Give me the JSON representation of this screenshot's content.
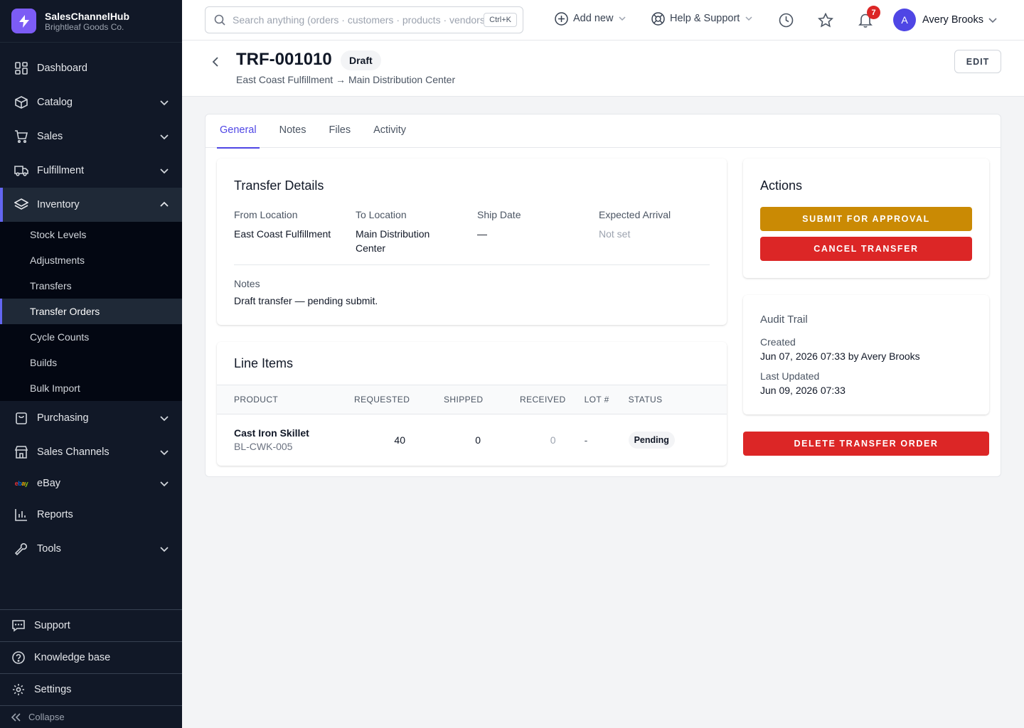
{
  "brand": {
    "name": "SalesChannelHub",
    "company": "Brightleaf Goods Co.",
    "logo_color": "#7c5cf5"
  },
  "sidebar": {
    "items": [
      {
        "label": "Dashboard",
        "icon": "dashboard-icon"
      },
      {
        "label": "Catalog",
        "icon": "box-icon"
      },
      {
        "label": "Sales",
        "icon": "cart-icon"
      },
      {
        "label": "Fulfillment",
        "icon": "truck-icon"
      },
      {
        "label": "Inventory",
        "icon": "layers-icon",
        "expanded": true
      }
    ],
    "inventory_sub": [
      "Stock Levels",
      "Adjustments",
      "Transfers",
      "Transfer Orders",
      "Cycle Counts",
      "Builds",
      "Bulk Import"
    ],
    "active_sub": "Transfer Orders",
    "items_after": [
      {
        "label": "Purchasing",
        "icon": "bag-icon"
      },
      {
        "label": "Sales Channels",
        "icon": "store-icon"
      },
      {
        "label": "eBay",
        "icon": "ebay-icon",
        "logo_text": "ebay"
      },
      {
        "label": "Reports",
        "icon": "bar-chart-icon"
      },
      {
        "label": "Tools",
        "icon": "wrench-icon"
      }
    ],
    "bottom": {
      "support": "Support",
      "knowledge": "Knowledge base",
      "settings": "Settings",
      "collapse": "Collapse"
    }
  },
  "topbar": {
    "search_placeholder": "Search anything (orders · customers · products · vendors)",
    "shortcut": "Ctrl+K",
    "add_new": "Add new",
    "help": "Help & Support",
    "notifications_count": "7",
    "user_initial": "A",
    "user_name": "Avery Brooks"
  },
  "header": {
    "title": "TRF-001010",
    "status": "Draft",
    "route": "East Coast Fulfillment → Main Distribution Center",
    "edit_label": "EDIT"
  },
  "tabs": [
    "General",
    "Notes",
    "Files",
    "Activity"
  ],
  "details": {
    "title": "Transfer Details",
    "from_label": "From Location",
    "from_value": "East Coast Fulfillment",
    "to_label": "To Location",
    "to_value": "Main Distribution Center",
    "ship_label": "Ship Date",
    "ship_value": "—",
    "arrival_label": "Expected Arrival",
    "arrival_value": "Not set",
    "notes_label": "Notes",
    "notes_value": "Draft transfer — pending submit."
  },
  "line_items": {
    "title": "Line Items",
    "columns": [
      "PRODUCT",
      "REQUESTED",
      "SHIPPED",
      "RECEIVED",
      "LOT #",
      "STATUS"
    ],
    "rows": [
      {
        "product": "Cast Iron Skillet",
        "sku": "BL-CWK-005",
        "requested": "40",
        "shipped": "0",
        "received": "0",
        "lot": "-",
        "status": "Pending"
      }
    ]
  },
  "actions": {
    "title": "Actions",
    "submit": "SUBMIT FOR APPROVAL",
    "cancel": "CANCEL TRANSFER",
    "submit_color": "#ca8a04",
    "cancel_color": "#dc2626"
  },
  "audit": {
    "title": "Audit Trail",
    "created_label": "Created",
    "created_value": "Jun 07, 2026 07:33 by Avery Brooks",
    "updated_label": "Last Updated",
    "updated_value": "Jun 09, 2026 07:33"
  },
  "delete_label": "DELETE TRANSFER ORDER",
  "accent_color": "#4f46e5"
}
